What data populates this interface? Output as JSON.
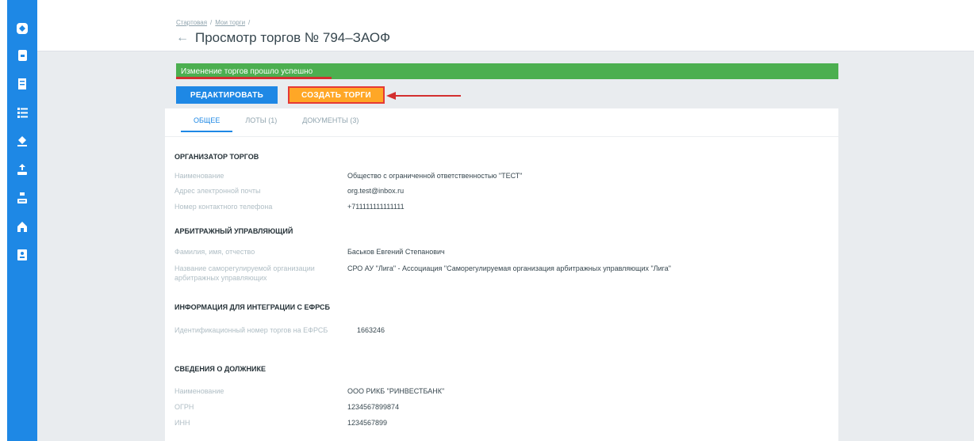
{
  "breadcrumb": [
    "Стартовая",
    "Мои торги"
  ],
  "page_title": "Просмотр торгов № 794–ЗАОФ",
  "alert": "Изменение торгов прошло успешно",
  "buttons": {
    "edit": "РЕДАКТИРОВАТЬ",
    "create": "СОЗДАТЬ ТОРГИ"
  },
  "tabs": [
    {
      "label": "ОБЩЕЕ",
      "active": true
    },
    {
      "label": "ЛОТЫ (1)",
      "active": false
    },
    {
      "label": "ДОКУМЕНТЫ (3)",
      "active": false
    }
  ],
  "sections": {
    "organizer": {
      "title": "ОРГАНИЗАТОР ТОРГОВ",
      "rows": [
        {
          "label": "Наименование",
          "value": "Общество с ограниченной ответственностью \"ТЕСТ\""
        },
        {
          "label": "Адрес электронной почты",
          "value": "org.test@inbox.ru"
        },
        {
          "label": "Номер контактного телефона",
          "value": "+711111111111111"
        }
      ]
    },
    "manager": {
      "title": "АРБИТРАЖНЫЙ УПРАВЛЯЮЩИЙ",
      "rows": [
        {
          "label": "Фамилия, имя, отчество",
          "value": "Баськов Евгений Степанович"
        },
        {
          "label": "Название саморегулируемой организации арбитражных управляющих",
          "value": "СРО АУ \"Лига\" - Ассоциация \"Саморегулируемая организация арбитражных управляющих \"Лига\""
        }
      ]
    },
    "efrsb": {
      "title": "ИНФОРМАЦИЯ ДЛЯ ИНТЕГРАЦИИ С ЕФРСБ",
      "rows": [
        {
          "label": "Идентификационный номер торгов на ЕФРСБ",
          "value": "1663246"
        }
      ]
    },
    "debtor": {
      "title": "СВЕДЕНИЯ О ДОЛЖНИКЕ",
      "rows": [
        {
          "label": "Наименование",
          "value": "ООО РИКБ \"РИНВЕСТБАНК\""
        },
        {
          "label": "ОГРН",
          "value": "1234567899874"
        },
        {
          "label": "ИНН",
          "value": "1234567899"
        }
      ]
    }
  },
  "sidebar_icons": [
    "logo-icon",
    "document-icon",
    "receipt-icon",
    "list-icon",
    "gavel-icon",
    "upload-icon",
    "download-icon",
    "house-icon",
    "contact-card-icon"
  ],
  "colors": {
    "primary": "#1e88e5",
    "success": "#4caf50",
    "accent": "#ffa726",
    "highlight": "#e53935"
  }
}
